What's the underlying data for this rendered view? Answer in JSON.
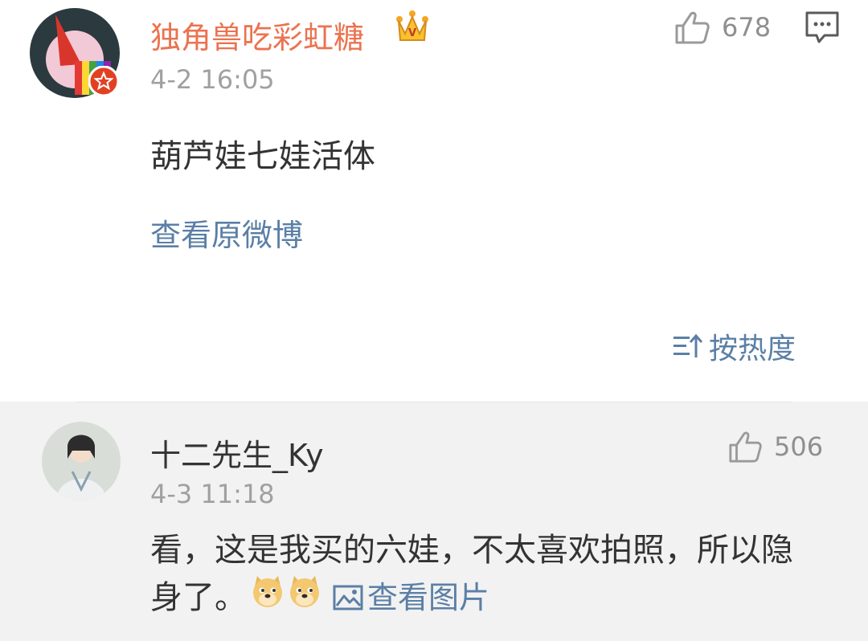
{
  "post": {
    "username": "独角兽吃彩虹糖",
    "badge_icon": "crown-icon",
    "time": "4-2 16:05",
    "like_count": "678",
    "text": "葫芦娃七娃活体",
    "view_original": "查看原微博",
    "sort_label": "按热度"
  },
  "reply": {
    "username": "十二先生_Ky",
    "time": "4-3 11:18",
    "like_count": "506",
    "text_line1": "看，这是我买的六娃，不太喜欢拍照，所以隐",
    "text_line2": "身了。",
    "emojis": [
      "doge-emoji",
      "doge-emoji"
    ],
    "view_image": "查看图片"
  },
  "colors": {
    "vip_name": "#eb7350",
    "link": "#5b7fa6",
    "muted": "#a0a0a0",
    "reply_bg": "#f2f2f2"
  }
}
